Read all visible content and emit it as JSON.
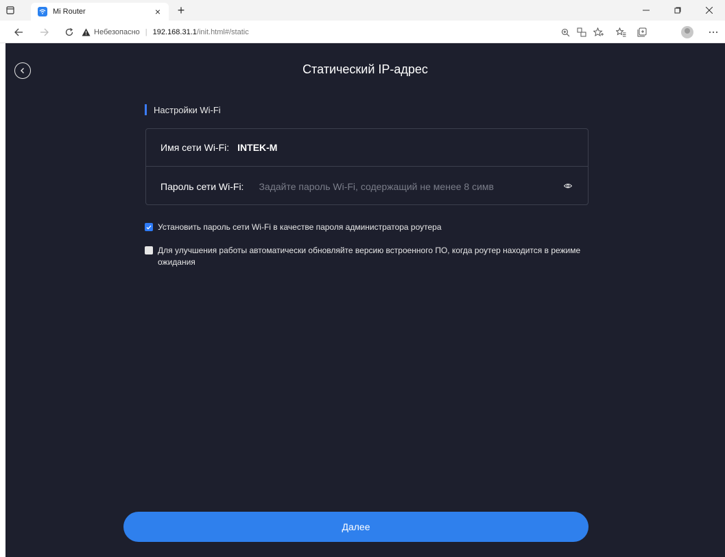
{
  "browser": {
    "tab_title": "Mi Router",
    "tab_close": "×",
    "new_tab": "+",
    "insecure_label": "Небезопасно",
    "url_host": "192.168.31.1",
    "url_path": "/init.html#/static"
  },
  "page": {
    "title": "Статический IP-адрес",
    "section_label": "Настройки Wi-Fi",
    "ssid_label": "Имя сети Wi-Fi:",
    "ssid_value": "INTEK-M",
    "password_label": "Пароль сети Wi-Fi:",
    "password_placeholder": "Задайте пароль Wi-Fi, содержащий не менее 8 симв",
    "password_value": "",
    "checkbox_admin_label": "Установить пароль сети Wi-Fi в качестве пароля администратора роутера",
    "checkbox_admin_checked": true,
    "checkbox_update_label": "Для улучшения работы автоматически обновляйте версию встроенного ПО, когда роутер находится в режиме ожидания",
    "checkbox_update_checked": false,
    "next_button": "Далее"
  },
  "colors": {
    "page_bg": "#1d1f2d",
    "accent": "#2f80ed",
    "section_bar": "#3b7cff"
  }
}
